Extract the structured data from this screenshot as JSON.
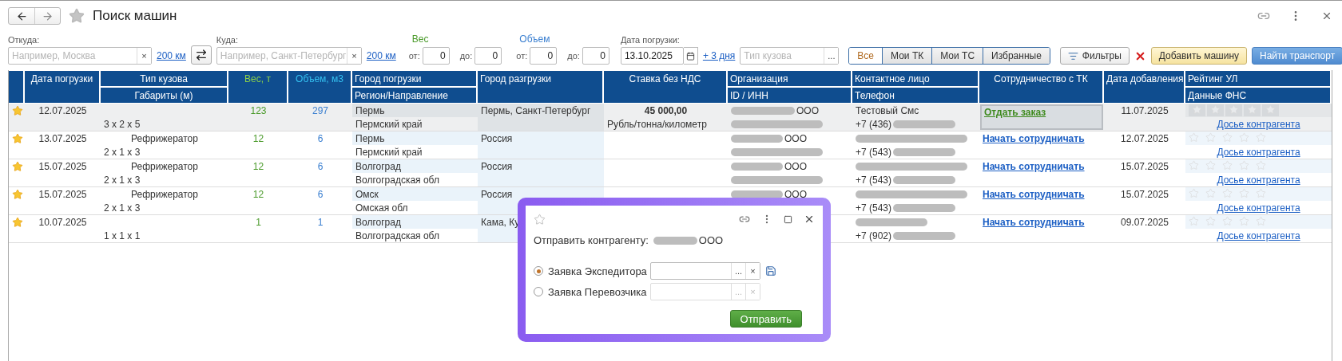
{
  "header": {
    "title": "Поиск машин"
  },
  "filters": {
    "from": {
      "label": "Откуда:",
      "placeholder": "Например, Москва",
      "clear": "×",
      "radius": "200 км"
    },
    "to": {
      "label": "Куда:",
      "placeholder": "Например, Санкт-Петербург",
      "clear": "×",
      "radius": "200 км"
    },
    "weight": {
      "label": "Вес",
      "from_label": "от:",
      "from": "0",
      "to_label": "до:",
      "to": "0"
    },
    "volume": {
      "label": "Объем",
      "from_label": "от:",
      "from": "0",
      "to_label": "до:",
      "to": "0"
    },
    "date": {
      "label": "Дата погрузки:",
      "value": "13.10.2025"
    },
    "plus_days": "+ 3 дня",
    "body_type": {
      "placeholder": "Тип кузова",
      "button": "..."
    },
    "segments": [
      {
        "label": "Все",
        "selected": true
      },
      {
        "label": "Мои ТК",
        "selected": false
      },
      {
        "label": "Мои ТС",
        "selected": false
      },
      {
        "label": "Избранные",
        "selected": false
      }
    ],
    "filters_button": "Фильтры",
    "add_button": "Добавить машину",
    "find_button": "Найти транспорт"
  },
  "table": {
    "columns": [
      {
        "kind": "text",
        "top": "Дата погрузки"
      },
      {
        "kind": "text",
        "top": "Тип кузова",
        "bottom": "Габариты (м)"
      },
      {
        "kind": "weight",
        "top": "Вес, т"
      },
      {
        "kind": "volume",
        "top": "Объем, м3"
      },
      {
        "kind": "text",
        "top": "Город погрузки",
        "bottom": "Регион/Направление"
      },
      {
        "kind": "text",
        "top": "Город разгрузки"
      },
      {
        "kind": "text",
        "top": "Ставка без НДС"
      },
      {
        "kind": "text",
        "top": "Организация",
        "bottom": "ID / ИНН"
      },
      {
        "kind": "text",
        "top": "Контактное лицо",
        "bottom": "Телефон"
      },
      {
        "kind": "text",
        "top": "Сотрудничество с ТК"
      },
      {
        "kind": "text",
        "top": "Дата добавления"
      },
      {
        "kind": "text",
        "top": "Рейтинг УЛ",
        "bottom": "Данные ФНС"
      }
    ],
    "rows": [
      {
        "selected": true,
        "favorite": true,
        "date": "12.07.2025",
        "dims": "3 x 2 x 5",
        "weight": "123",
        "volume": "297",
        "load_city": "Пермь",
        "load_region": "Пермский край",
        "unload": "Пермь, Санкт-Петербург",
        "rate": "45 000,00",
        "rate_unit": "Рубль/тонна/километр",
        "org": "ООО",
        "contact": "Тестовый Смс",
        "phone": "+7 (436)",
        "action": {
          "kind": "order",
          "label": "Отдать заказ"
        },
        "added": "11.07.2025",
        "stars": 0,
        "dossier": "Досье контрагента"
      },
      {
        "selected": false,
        "favorite": true,
        "date": "13.07.2025",
        "body_type": "Рефрижератор",
        "dims": "2 x 1 x 3",
        "weight": "12",
        "volume": "6",
        "load_city": "Пермь",
        "load_region": "Пермский край",
        "unload": "Россия",
        "org": "ООО",
        "phone": "+7 (543)",
        "action": {
          "kind": "cooperate",
          "label": "Начать сотрудничать"
        },
        "added": "12.07.2025",
        "stars": 0,
        "dossier": "Досье контрагента"
      },
      {
        "selected": false,
        "favorite": true,
        "date": "15.07.2025",
        "body_type": "Рефрижератор",
        "dims": "2 x 1 x 3",
        "weight": "12",
        "volume": "6",
        "load_city": "Волгоград",
        "load_region": "Волгоградская обл",
        "unload": "Россия",
        "org": "ООО",
        "phone": "+7 (543)",
        "action": {
          "kind": "cooperate",
          "label": "Начать сотрудничать"
        },
        "added": "15.07.2025",
        "stars": 0,
        "dossier": "Досье контрагента"
      },
      {
        "selected": false,
        "favorite": true,
        "date": "15.07.2025",
        "body_type": "Рефрижератор",
        "dims": "2 x 1 x 3",
        "weight": "12",
        "volume": "6",
        "load_city": "Омск",
        "load_region": "Омская обл",
        "unload": "Россия",
        "org": "ООО",
        "phone": "+7 (543)",
        "action": {
          "kind": "cooperate",
          "label": "Начать сотрудничать"
        },
        "added": "15.07.2025",
        "stars": 0,
        "dossier": "Досье контрагента"
      },
      {
        "selected": false,
        "favorite": true,
        "date": "10.07.2025",
        "dims": "1 x 1 x 1",
        "weight": "1",
        "volume": "1",
        "load_city": "Волгоград",
        "load_region": "Волгоградская обл",
        "unload": "Кама, Ку",
        "phone": "+7 (902)",
        "action": {
          "kind": "cooperate",
          "label": "Начать сотрудничать"
        },
        "added": "09.07.2025",
        "stars": 0,
        "dossier": "Досье контрагента"
      }
    ]
  },
  "dialog": {
    "favorite": false,
    "label": "Отправить контрагенту:",
    "org": "ООО",
    "options": [
      {
        "label": "Заявка Экспедитора",
        "selected": true,
        "disabled": false,
        "pick": "...",
        "clear": "×"
      },
      {
        "label": "Заявка Перевозчика",
        "selected": false,
        "disabled": true,
        "pick": "...",
        "clear": "×"
      }
    ],
    "submit": "Отправить"
  }
}
